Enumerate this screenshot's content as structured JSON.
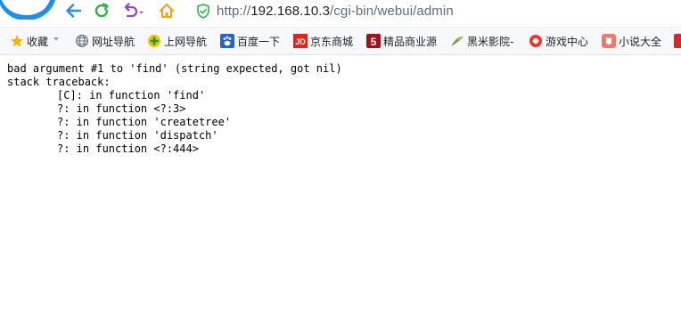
{
  "browser": {
    "url_prefix": "http://",
    "url_host": "192.168.10.3",
    "url_path": "/cgi-bin/webui/admin",
    "icons": {
      "back": "back-arrow-icon",
      "refresh": "refresh-icon",
      "undo": "undo-icon",
      "home": "home-icon",
      "shield": "shield-icon"
    },
    "colors": {
      "back": "#2a8cf0",
      "refresh": "#2fb344",
      "undo": "#8a4cd0",
      "home": "#f3a21b",
      "shield": "#2fb344",
      "logo": "#1e8ff0"
    }
  },
  "bookmarks": {
    "items": [
      {
        "label": "收藏",
        "icon": "star-icon"
      },
      {
        "label": "网址导航",
        "icon": "globe-icon"
      },
      {
        "label": "上网导航",
        "icon": "plus-circle-icon"
      },
      {
        "label": "百度一下",
        "icon": "baidu-paw-icon"
      },
      {
        "label": "京东商城",
        "icon": "jd-icon"
      },
      {
        "label": "精品商业源",
        "icon": "five-icon"
      },
      {
        "label": "黑米影院-",
        "icon": "leaf-icon"
      },
      {
        "label": "游戏中心",
        "icon": "game-icon"
      },
      {
        "label": "小说大全",
        "icon": "book-icon"
      },
      {
        "label": "",
        "icon": "overflow-icon"
      }
    ]
  },
  "page": {
    "lines": [
      "bad argument #1 to 'find' (string expected, got nil)",
      "stack traceback:",
      "[C]: in function 'find'",
      "?: in function <?:3>",
      "?: in function 'createtree'",
      "?: in function 'dispatch'",
      "?: in function <?:444>"
    ]
  }
}
